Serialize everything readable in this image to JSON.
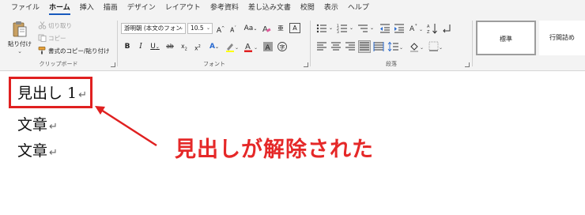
{
  "menu": {
    "tabs": [
      "ファイル",
      "ホーム",
      "挿入",
      "描画",
      "デザイン",
      "レイアウト",
      "参考資料",
      "差し込み文書",
      "校閲",
      "表示",
      "ヘルプ"
    ],
    "active_index": 1
  },
  "ribbon": {
    "clipboard": {
      "paste_label": "貼り付け",
      "cut_label": "切り取り",
      "copy_label": "コピー",
      "format_painter_label": "書式のコピー/貼り付け",
      "group_label": "クリップボード"
    },
    "font": {
      "font_name": "游明朝 (本文のフォン",
      "font_size": "10.5",
      "group_label": "フォント"
    },
    "paragraph": {
      "group_label": "段落"
    },
    "styles": {
      "style_normal": "標準",
      "style_no_spacing": "行間詰め"
    }
  },
  "document": {
    "lines": [
      "見出し 1",
      "文章",
      "文章"
    ]
  },
  "annotation": {
    "text": "見出しが解除された",
    "color": "#e52828"
  },
  "colors": {
    "accent": "#185abd",
    "highlight_border": "#e02020",
    "font_color_bar": "#e02020",
    "highlighter_bar": "#ffff00"
  }
}
